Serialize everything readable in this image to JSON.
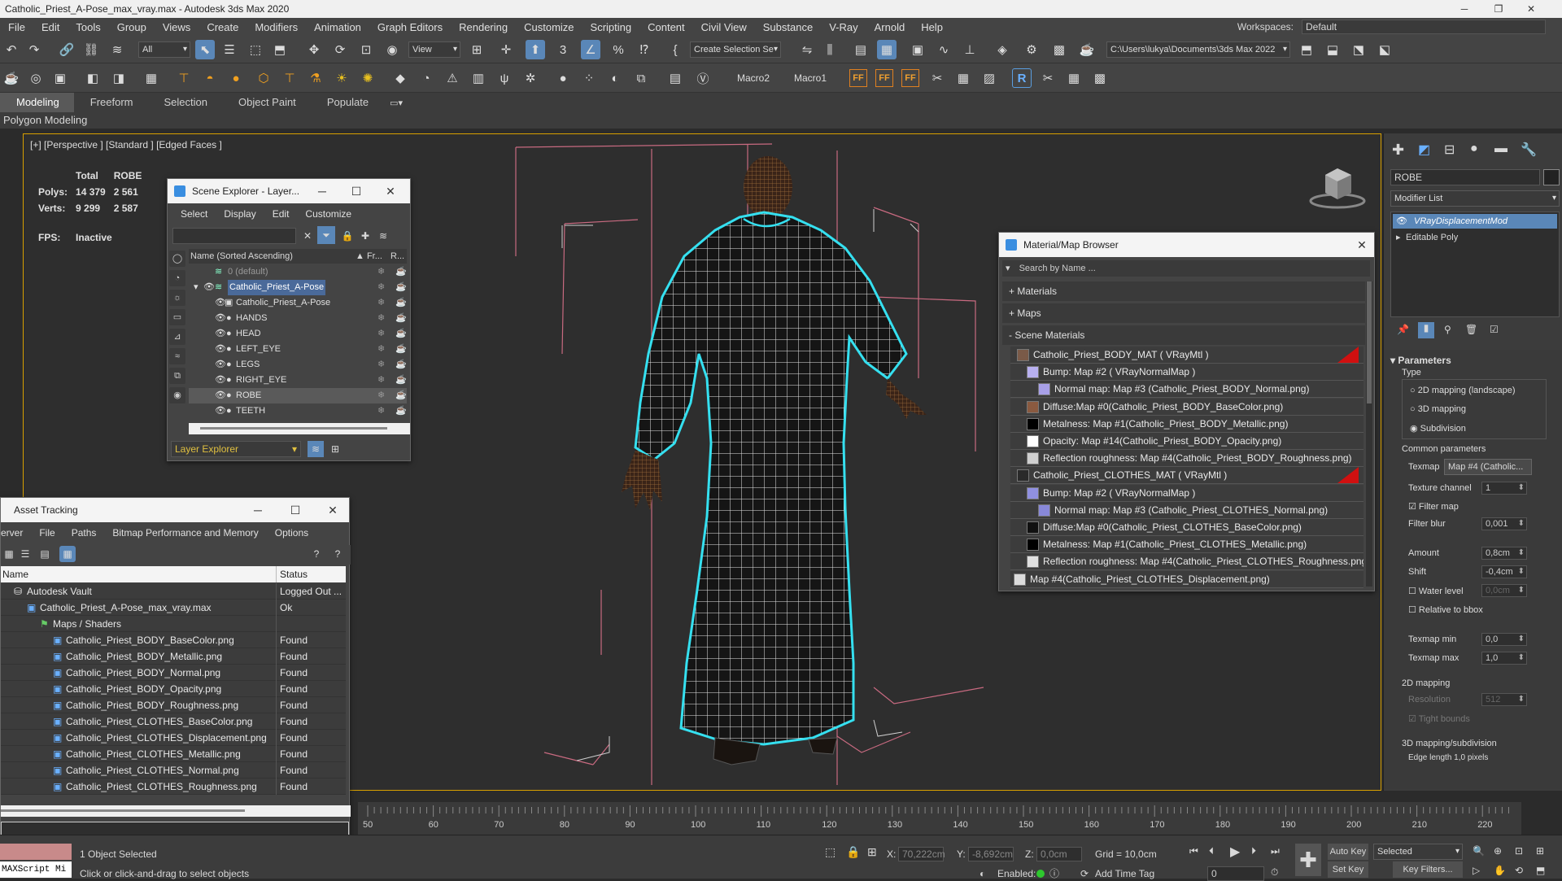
{
  "window": {
    "title": "Catholic_Priest_A-Pose_max_vray.max - Autodesk 3ds Max 2020"
  },
  "menu": [
    "File",
    "Edit",
    "Tools",
    "Group",
    "Views",
    "Create",
    "Modifiers",
    "Animation",
    "Graph Editors",
    "Rendering",
    "Customize",
    "Scripting",
    "Content",
    "Civil View",
    "Substance",
    "V-Ray",
    "Arnold",
    "Help"
  ],
  "workspaces": {
    "label": "Workspaces:",
    "value": "Default"
  },
  "toolbar": {
    "filter_dropdown": "All",
    "view_dropdown": "View",
    "selection_set": "Create Selection Se",
    "project_path": "C:\\Users\\lukya\\Documents\\3ds Max 2022",
    "macro2": "Macro2",
    "macro1": "Macro1"
  },
  "ribbon": {
    "tabs": [
      "Modeling",
      "Freeform",
      "Selection",
      "Object Paint",
      "Populate"
    ],
    "active": "Modeling",
    "sub": "Polygon Modeling"
  },
  "viewport": {
    "label": "[+] [Perspective ] [Standard ] [Edged Faces ]",
    "stats": {
      "col_total": "Total",
      "col_sel": "ROBE",
      "polys_label": "Polys:",
      "polys_total": "14 379",
      "polys_sel": "2 561",
      "verts_label": "Verts:",
      "verts_total": "9 299",
      "verts_sel": "2 587",
      "fps_label": "FPS:",
      "fps_value": "Inactive"
    }
  },
  "scene_explorer": {
    "title": "Scene Explorer - Layer...",
    "menu": [
      "Select",
      "Display",
      "Edit",
      "Customize"
    ],
    "col_name": "Name (Sorted Ascending)",
    "col_fr": "▲ Fr...",
    "col_r": "R...",
    "rows": [
      {
        "name": "0 (default)",
        "indent": 0,
        "dim": true
      },
      {
        "name": "Catholic_Priest_A-Pose",
        "indent": 1,
        "layer": true
      },
      {
        "name": "Catholic_Priest_A-Pose",
        "indent": 2
      },
      {
        "name": "HANDS",
        "indent": 2
      },
      {
        "name": "HEAD",
        "indent": 2
      },
      {
        "name": "LEFT_EYE",
        "indent": 2
      },
      {
        "name": "LEGS",
        "indent": 2
      },
      {
        "name": "RIGHT_EYE",
        "indent": 2
      },
      {
        "name": "ROBE",
        "indent": 2,
        "selected": true
      },
      {
        "name": "TEETH",
        "indent": 2
      }
    ],
    "footer_dropdown": "Layer Explorer"
  },
  "asset_tracking": {
    "title": "Asset Tracking",
    "menu": [
      "erver",
      "File",
      "Paths",
      "Bitmap Performance and Memory",
      "Options"
    ],
    "col_name": "Name",
    "col_status": "Status",
    "rows": [
      {
        "name": "Autodesk Vault",
        "status": "Logged Out ...",
        "indent": 1
      },
      {
        "name": "Catholic_Priest_A-Pose_max_vray.max",
        "status": "Ok",
        "indent": 2
      },
      {
        "name": "Maps / Shaders",
        "status": "",
        "indent": 3
      },
      {
        "name": "Catholic_Priest_BODY_BaseColor.png",
        "status": "Found",
        "indent": 4
      },
      {
        "name": "Catholic_Priest_BODY_Metallic.png",
        "status": "Found",
        "indent": 4
      },
      {
        "name": "Catholic_Priest_BODY_Normal.png",
        "status": "Found",
        "indent": 4
      },
      {
        "name": "Catholic_Priest_BODY_Opacity.png",
        "status": "Found",
        "indent": 4
      },
      {
        "name": "Catholic_Priest_BODY_Roughness.png",
        "status": "Found",
        "indent": 4
      },
      {
        "name": "Catholic_Priest_CLOTHES_BaseColor.png",
        "status": "Found",
        "indent": 4
      },
      {
        "name": "Catholic_Priest_CLOTHES_Displacement.png",
        "status": "Found",
        "indent": 4
      },
      {
        "name": "Catholic_Priest_CLOTHES_Metallic.png",
        "status": "Found",
        "indent": 4
      },
      {
        "name": "Catholic_Priest_CLOTHES_Normal.png",
        "status": "Found",
        "indent": 4
      },
      {
        "name": "Catholic_Priest_CLOTHES_Roughness.png",
        "status": "Found",
        "indent": 4
      }
    ]
  },
  "material_browser": {
    "title": "Material/Map Browser",
    "search_placeholder": "Search by Name ...",
    "cat_materials": "+ Materials",
    "cat_maps": "+ Maps",
    "cat_scene": "- Scene Materials",
    "rows": [
      {
        "text": "Catholic_Priest_BODY_MAT  ( VRayMtl )",
        "indent": 0,
        "swatch": "#7a5a48",
        "red": true
      },
      {
        "text": "Bump: Map #2  ( VRayNormalMap )",
        "indent": 1,
        "swatch": "#b8b0f0"
      },
      {
        "text": "Normal map: Map #3 (Catholic_Priest_BODY_Normal.png)",
        "indent": 2,
        "swatch": "#a8a0e8"
      },
      {
        "text": "Diffuse:Map #0(Catholic_Priest_BODY_BaseColor.png)",
        "indent": 1,
        "swatch": "#8a5a40"
      },
      {
        "text": "Metalness: Map #1(Catholic_Priest_BODY_Metallic.png)",
        "indent": 1,
        "swatch": "#000000"
      },
      {
        "text": "Opacity: Map #14(Catholic_Priest_BODY_Opacity.png)",
        "indent": 1,
        "swatch": "#ffffff"
      },
      {
        "text": "Reflection roughness: Map #4(Catholic_Priest_BODY_Roughness.png)",
        "indent": 1,
        "swatch": "#cfcfcf"
      },
      {
        "text": "Catholic_Priest_CLOTHES_MAT  ( VRayMtl )",
        "indent": 0,
        "swatch": "#2a2a2a",
        "red": true
      },
      {
        "text": "Bump: Map #2  ( VRayNormalMap )",
        "indent": 1,
        "swatch": "#9090e0"
      },
      {
        "text": "Normal map: Map #3 (Catholic_Priest_CLOTHES_Normal.png)",
        "indent": 2,
        "swatch": "#8888d8"
      },
      {
        "text": "Diffuse:Map #0(Catholic_Priest_CLOTHES_BaseColor.png)",
        "indent": 1,
        "swatch": "#111111"
      },
      {
        "text": "Metalness: Map #1(Catholic_Priest_CLOTHES_Metallic.png)",
        "indent": 1,
        "swatch": "#000000"
      },
      {
        "text": "Reflection roughness: Map #4(Catholic_Priest_CLOTHES_Roughness.png)",
        "indent": 1,
        "swatch": "#e0e0e0"
      },
      {
        "text": "Map #4(Catholic_Priest_CLOTHES_Displacement.png)",
        "indent": 0,
        "swatch": "#dcdcdc",
        "outer": true
      }
    ]
  },
  "command_panel": {
    "object_name": "ROBE",
    "modifier_list": "Modifier List",
    "stack": [
      "VRayDisplacementMod",
      "Editable Poly"
    ],
    "rollout": "Parameters",
    "type_label": "Type",
    "type_options": [
      "2D mapping (landscape)",
      "3D mapping",
      "Subdivision"
    ],
    "type_selected": "Subdivision",
    "common": "Common parameters",
    "texmap_label": "Texmap",
    "texmap_value": "Map #4 (Catholic...",
    "tex_channel_label": "Texture channel",
    "tex_channel_value": "1",
    "filter_map": "Filter map",
    "filter_blur_label": "Filter blur",
    "filter_blur_value": "0,001",
    "amount_label": "Amount",
    "amount_value": "0,8cm",
    "shift_label": "Shift",
    "shift_value": "-0,4cm",
    "water_level_label": "Water level",
    "water_level_value": "0,0cm",
    "relative_bbox": "Relative to bbox",
    "texmap_min_label": "Texmap min",
    "texmap_min_value": "0,0",
    "texmap_max_label": "Texmap max",
    "texmap_max_value": "1,0",
    "mapping2d": "2D mapping",
    "resolution_label": "Resolution",
    "resolution_value": "512",
    "tight_bounds": "Tight bounds",
    "mapping3d": "3D mapping/subdivision",
    "edge_length": "Edge length  1,0   pixels"
  },
  "timeline": {
    "ticks": [
      "50",
      "60",
      "70",
      "80",
      "90",
      "100",
      "110",
      "120",
      "130",
      "140",
      "150",
      "160",
      "170",
      "180",
      "190",
      "200",
      "210",
      "220"
    ]
  },
  "status": {
    "maxscript": "MAXScript Mi",
    "selection": "1 Object Selected",
    "prompt": "Click or click-and-drag to select objects",
    "x_label": "X:",
    "x_value": "70,222cm",
    "y_label": "Y:",
    "y_value": "-8,692cm",
    "z_label": "Z:",
    "z_value": "0,0cm",
    "grid": "Grid = 10,0cm",
    "enabled": "Enabled:",
    "add_time_tag": "Add Time Tag",
    "auto_key": "Auto Key",
    "set_key": "Set Key",
    "key_selected": "Selected",
    "key_filters": "Key Filters...",
    "frame": "0"
  }
}
